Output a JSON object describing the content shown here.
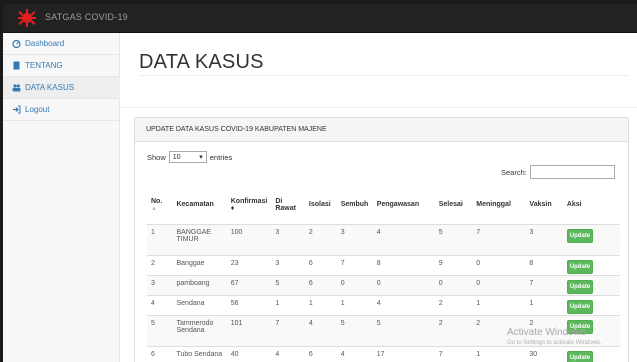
{
  "navbar": {
    "brand": "SATGAS COVID-19"
  },
  "sidebar": {
    "items": [
      {
        "label": "Dashboard"
      },
      {
        "label": "TENTANG"
      },
      {
        "label": "DATA KASUS"
      },
      {
        "label": "Logout"
      }
    ]
  },
  "main": {
    "title": "DATA KASUS",
    "panel_heading": "UPDATE DATA KASUS COVID-19 KABUPATEN MAJENE",
    "show_label": "Show",
    "show_value": "10",
    "entries_label": "entries",
    "search_label": "Search:"
  },
  "table": {
    "headers": [
      "No.",
      "Kecamatan",
      "Konfirmasi",
      "Di Rawat",
      "Isolasi",
      "Sembuh",
      "Pengawasan",
      "Selesai",
      "Meninggal",
      "Vaksin",
      "Aksi"
    ],
    "rows": [
      [
        "1",
        "BANGGAE TIMUR",
        "100",
        "3",
        "2",
        "3",
        "4",
        "5",
        "7",
        "3"
      ],
      [
        "2",
        "Banggae",
        "23",
        "3",
        "6",
        "7",
        "8",
        "9",
        "0",
        "8"
      ],
      [
        "3",
        "pamboang",
        "67",
        "5",
        "6",
        "0",
        "0",
        "0",
        "0",
        "7"
      ],
      [
        "4",
        "Sendana",
        "56",
        "1",
        "1",
        "1",
        "4",
        "2",
        "1",
        "1"
      ],
      [
        "5",
        "Tammerodo Sendana",
        "101",
        "7",
        "4",
        "5",
        "5",
        "2",
        "2",
        "2"
      ],
      [
        "6",
        "Tubo Sendana",
        "40",
        "4",
        "6",
        "4",
        "17",
        "7",
        "1",
        "30"
      ]
    ],
    "action_label": "Update"
  },
  "watermark": {
    "line1": "Activate Windows",
    "line2": "Go to Settings to activate Windows."
  },
  "colors": {
    "navbar": "#222222",
    "update_button": "#5cb85c",
    "link": "#337ab7",
    "logo": "#e02020"
  }
}
